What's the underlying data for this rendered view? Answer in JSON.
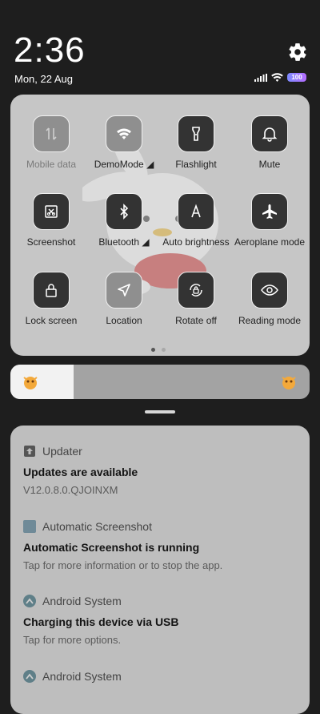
{
  "clock": {
    "time": "2:36",
    "date": "Mon, 22 Aug"
  },
  "status": {
    "battery": "100"
  },
  "quick_settings": {
    "tiles": [
      {
        "label": "Mobile data",
        "icon": "mobile-data-icon",
        "active": false
      },
      {
        "label": "DemoMode ◢",
        "icon": "wifi-icon",
        "active": false
      },
      {
        "label": "Flashlight",
        "icon": "flashlight-icon",
        "active": true
      },
      {
        "label": "Mute",
        "icon": "bell-icon",
        "active": true
      },
      {
        "label": "Screenshot",
        "icon": "screenshot-icon",
        "active": true
      },
      {
        "label": "Bluetooth ◢",
        "icon": "bluetooth-icon",
        "active": true
      },
      {
        "label": "Auto brightness",
        "icon": "auto-brightness-icon",
        "active": true
      },
      {
        "label": "Aeroplane mode",
        "icon": "aeroplane-icon",
        "active": true
      },
      {
        "label": "Lock screen",
        "icon": "lock-icon",
        "active": true
      },
      {
        "label": "Location",
        "icon": "location-icon",
        "active": false
      },
      {
        "label": "Rotate off",
        "icon": "rotate-icon",
        "active": true
      },
      {
        "label": "Reading mode",
        "icon": "eye-icon",
        "active": true
      }
    ],
    "page_count": 2,
    "current_page": 1
  },
  "brightness": {
    "level": 0.21
  },
  "notifications": [
    {
      "app": "Updater",
      "title": "Updates are available",
      "body": "V12.0.8.0.QJOINXM"
    },
    {
      "app": "Automatic Screenshot",
      "title": "Automatic Screenshot is running",
      "body": "Tap for more information or to stop the app."
    },
    {
      "app": "Android System",
      "title": "Charging this device via USB",
      "body": "Tap for more options."
    },
    {
      "app": "Android System",
      "title": "",
      "body": ""
    }
  ],
  "colors": {
    "tile_on": "#333333",
    "tile_off": "#8f8f8f",
    "panel": "#c6c6c6",
    "background": "#1e1e1e"
  }
}
